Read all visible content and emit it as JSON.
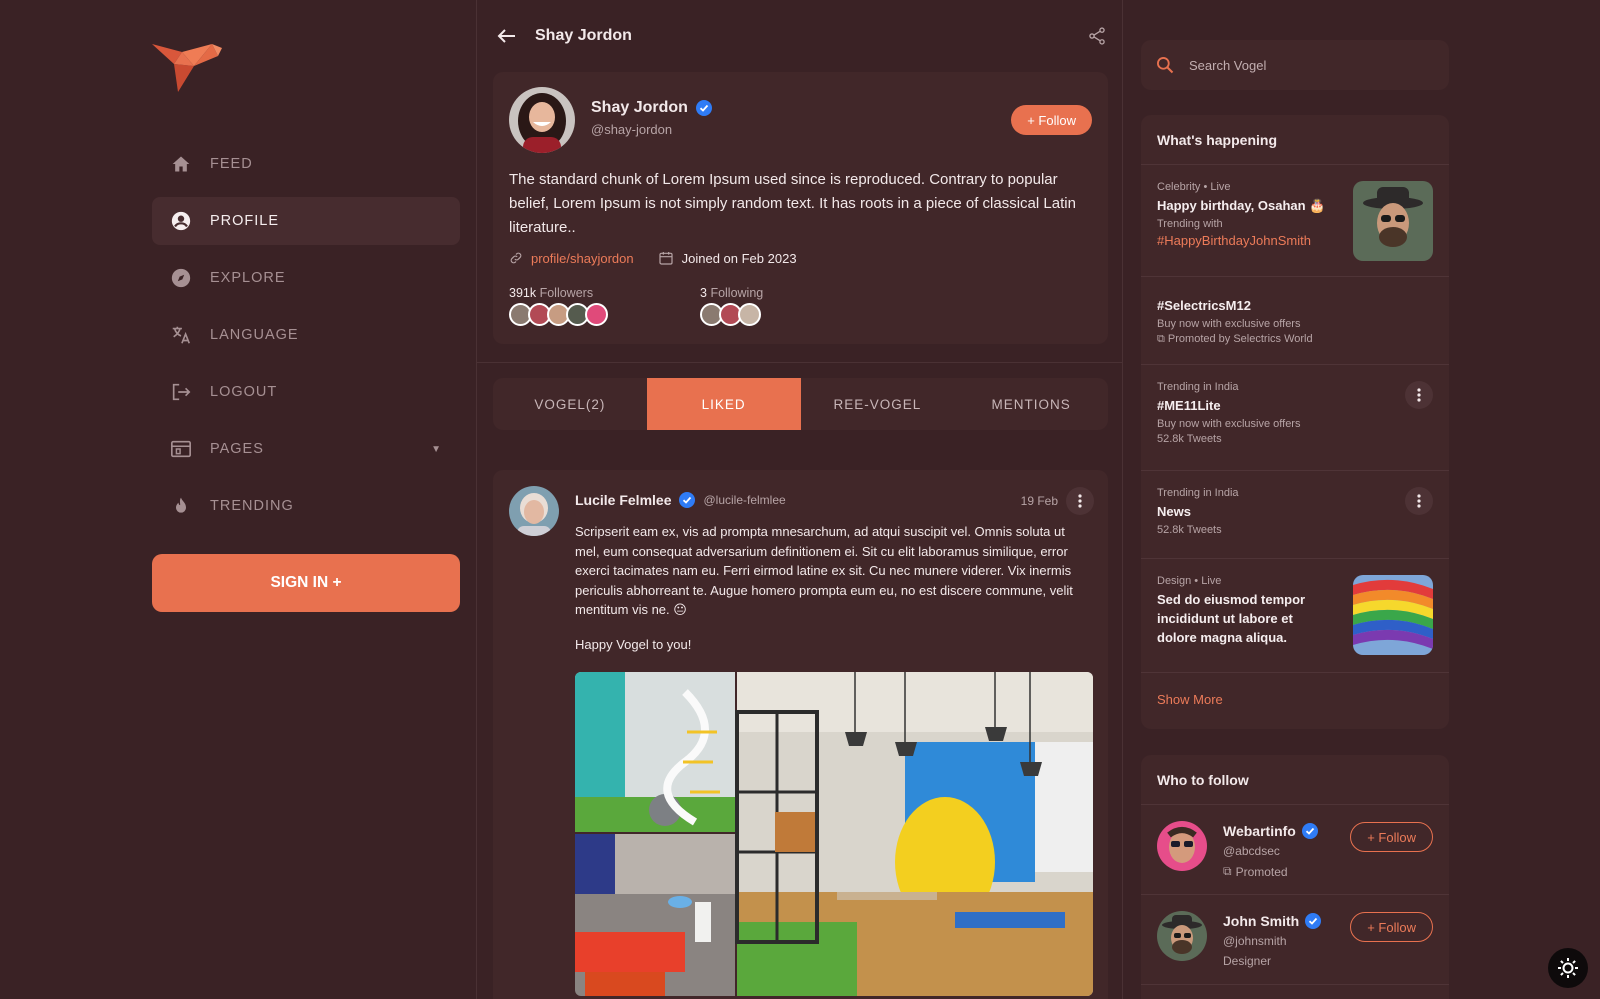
{
  "sidebar": {
    "items": [
      {
        "label": "FEED",
        "icon": "home-icon"
      },
      {
        "label": "PROFILE",
        "icon": "user-circle-icon"
      },
      {
        "label": "EXPLORE",
        "icon": "compass-icon"
      },
      {
        "label": "LANGUAGE",
        "icon": "translate-icon"
      },
      {
        "label": "LOGOUT",
        "icon": "logout-icon"
      },
      {
        "label": "PAGES",
        "icon": "browser-icon"
      },
      {
        "label": "TRENDING",
        "icon": "flame-icon"
      }
    ],
    "active": "PROFILE",
    "signin_label": "SIGN IN +"
  },
  "header": {
    "title": "Shay Jordon"
  },
  "profile": {
    "name": "Shay Jordon",
    "handle": "@shay-jordon",
    "follow_label": "+ Follow",
    "bio": "The standard chunk of Lorem Ipsum used since is reproduced. Contrary to popular belief, Lorem Ipsum is not simply random text. It has roots in a piece of classical Latin literature..",
    "link": "profile/shayjordon",
    "joined": "Joined on Feb 2023",
    "followers_count": "391k",
    "followers_label": "Followers",
    "following_count": "3",
    "following_label": "Following"
  },
  "tabs": [
    {
      "label": "VOGEL(2)"
    },
    {
      "label": "LIKED"
    },
    {
      "label": "REE-VOGEL"
    },
    {
      "label": "MENTIONS"
    }
  ],
  "active_tab": "LIKED",
  "post": {
    "author": "Lucile Felmlee",
    "handle": "@lucile-felmlee",
    "date": "19 Feb",
    "text": "Scripserit eam ex, vis ad prompta mnesarchum, ad atqui suscipit vel. Omnis soluta ut mel, eum consequat adversarium definitionem ei. Sit cu elit laboramus similique, error exerci tacimates nam eu. Ferri eirmod latine ex sit. Cu nec munere viderer. Vix inermis periculis abhorreant te. Augue homero prompta eum eu, no est discere commune, velit mentitum vis ne. 😐",
    "text2": "Happy Vogel to you!"
  },
  "search": {
    "placeholder": "Search Vogel"
  },
  "happening": {
    "title": "What's happening",
    "items": [
      {
        "category": "Celebrity • Live",
        "title": "Happy birthday, Osahan 🎂",
        "sub": "Trending with",
        "tag": "#HappyBirthdayJohnSmith"
      },
      {
        "title": "#SelectricsM12",
        "sub": "Buy now with exclusive offers",
        "promoted": "Promoted by Selectrics World"
      },
      {
        "category": "Trending in India",
        "title": "#ME11Lite",
        "sub": "Buy now with exclusive offers",
        "count": "52.8k Tweets"
      },
      {
        "category": "Trending in India",
        "title": "News",
        "count": "52.8k Tweets"
      },
      {
        "category": "Design • Live",
        "title": "Sed do eiusmod tempor incididunt ut labore et dolore magna aliqua."
      }
    ],
    "show_more": "Show More"
  },
  "who_to_follow": {
    "title": "Who to follow",
    "items": [
      {
        "name": "Webartinfo",
        "handle": "@abcdsec",
        "extra": "Promoted",
        "follow_label": "+ Follow"
      },
      {
        "name": "John Smith",
        "handle": "@johnsmith",
        "extra": "Designer",
        "follow_label": "+ Follow"
      }
    ]
  },
  "colors": {
    "accent": "#e8714f",
    "background": "#3a2225",
    "card": "#412729",
    "verified": "#2f7cf6"
  }
}
